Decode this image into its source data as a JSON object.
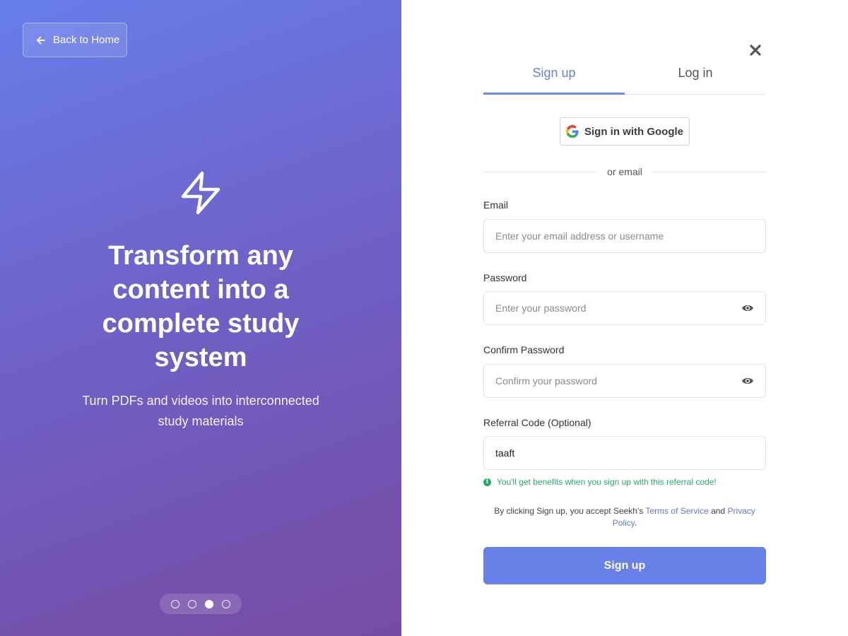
{
  "hero": {
    "back_label": "Back to Home",
    "headline": "Transform any content into a complete study system",
    "subhead": "Turn PDFs and videos into interconnected study materials",
    "carousel": {
      "count": 4,
      "active_index": 2
    }
  },
  "auth": {
    "tabs": [
      {
        "label": "Sign up",
        "active": true
      },
      {
        "label": "Log in",
        "active": false
      }
    ],
    "google_label": "Sign in with Google",
    "divider_text": "or email",
    "email": {
      "label": "Email",
      "placeholder": "Enter your email address or username",
      "value": ""
    },
    "password": {
      "label": "Password",
      "placeholder": "Enter your password",
      "value": ""
    },
    "confirm": {
      "label": "Confirm Password",
      "placeholder": "Confirm your password",
      "value": ""
    },
    "referral": {
      "label": "Referral Code (Optional)",
      "placeholder": "",
      "value": "taaft"
    },
    "referral_info": "You'll get benefits when you sign up with this referral code!",
    "terms": {
      "prefix": "By clicking Sign up, you accept Seekh's ",
      "tos": "Terms of Service",
      "and": " and ",
      "privacy": "Privacy Policy",
      "suffix": "."
    },
    "submit_label": "Sign up"
  },
  "colors": {
    "gradient_start": "#667eea",
    "gradient_end": "#764ba2",
    "primary_button": "#6781e8",
    "active_tab": "#6a83cc",
    "success": "#27a86a",
    "link": "#5b7bd4"
  },
  "icons": {
    "back": "arrow-left-icon",
    "hero": "lightning-bolt-icon",
    "close": "close-icon",
    "google": "google-logo-icon",
    "reveal": "eye-icon",
    "info": "info-icon"
  }
}
